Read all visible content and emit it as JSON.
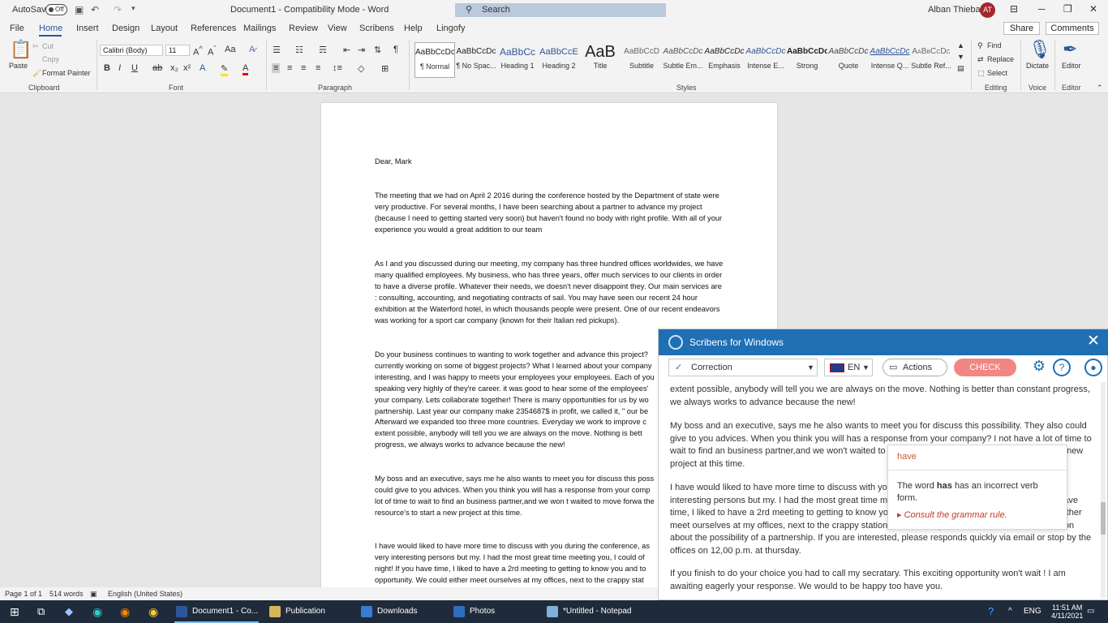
{
  "titlebar": {
    "autosave_label": "AutoSave",
    "autosave_state": "Off",
    "title": "Document1  -  Compatibility Mode  -  Word",
    "search_placeholder": "Search",
    "user_name": "Alban Thiebaut",
    "user_initials": "AT"
  },
  "menubar": {
    "tabs": [
      "File",
      "Home",
      "Insert",
      "Design",
      "Layout",
      "References",
      "Mailings",
      "Review",
      "View",
      "Scribens",
      "Help",
      "Lingofy"
    ],
    "active_tab": "Home",
    "share_label": "Share",
    "comments_label": "Comments"
  },
  "ribbon": {
    "clipboard": {
      "paste": "Paste",
      "cut": "Cut",
      "copy": "Copy",
      "format_painter": "Format Painter",
      "label": "Clipboard"
    },
    "font": {
      "name": "Calibri (Body)",
      "size": "11",
      "label": "Font"
    },
    "paragraph": {
      "label": "Paragraph"
    },
    "styles": {
      "label": "Styles",
      "items": [
        {
          "preview": "AaBbCcDc",
          "name": "¶ Normal"
        },
        {
          "preview": "AaBbCcDc",
          "name": "¶ No Spac..."
        },
        {
          "preview": "AaBbCc",
          "name": "Heading 1"
        },
        {
          "preview": "AaBbCcE",
          "name": "Heading 2"
        },
        {
          "preview": "AaB",
          "name": "Title"
        },
        {
          "preview": "AaBbCcD",
          "name": "Subtitle"
        },
        {
          "preview": "AaBbCcDc",
          "name": "Subtle Em..."
        },
        {
          "preview": "AaBbCcDc",
          "name": "Emphasis"
        },
        {
          "preview": "AaBbCcDc",
          "name": "Intense E..."
        },
        {
          "preview": "AaBbCcDc",
          "name": "Strong"
        },
        {
          "preview": "AaBbCcDc",
          "name": "Quote"
        },
        {
          "preview": "AaBbCcDc",
          "name": "Intense Q..."
        },
        {
          "preview": "AaBbCcDc",
          "name": "Subtle Ref..."
        }
      ]
    },
    "editing": {
      "find": "Find",
      "replace": "Replace",
      "select": "Select",
      "label": "Editing"
    },
    "voice": {
      "dictate": "Dictate",
      "label": "Voice"
    },
    "editor": {
      "editor": "Editor",
      "label": "Editor"
    }
  },
  "document": {
    "salutation": "Dear, Mark",
    "p1": "The meeting that we had on April 2 2016 during the conference hosted by the Department of state were very productive. For several months, I have been searching about a partner to advance my project (because I need to getting started very soon) but haven't found no body with right profile. With all of your experience you would a great addition to our team",
    "p2": "As I and you discussed during our meeting, my company has three hundred offices worldwides, we have many qualified employees. My business, who has three years, offer much services to our clients in order to have a diverse profile. Whatever their needs, we doesn't never disappoint they. Our main services are : consulting, accounting, and negotiating contracts of sail. You may have seen our recent 24 hour exhibition at the Waterford hotel, in which thousands people were present. One of our recent endeavors was working for a sport car company (known for their Italian red pickups).",
    "p3": "Do your business continues to wanting to work together and advance this project? currently working on some of biggest projects? What I learned about your company interesting, and I was happy to meets your employees your employees. Each of you speaking very highly of they're career. it was good to hear some of the employees' your company. Lets collaborate together! There is many opportunities for us by wo partnership. Last year our company make 2354687$ in profit, we called it, \" our be Afterward we expanded too three more countries. Everyday we work to improve c extent possible, anybody will tell you we are always on the move.   Nothing is bett progress, we always works to advance because the new!",
    "p4": "My boss and an executive, says me he also wants to meet you for discuss this poss could give to you advices. When you think you will has a response from your comp lot of time to wait to find an business partner,and we won t waited to move forwa the resource's to start a new project at this time.",
    "p5": "I have would liked to have more time to discuss with you during the conference, as very interesting persons but my. I had the most great time meeting you, I could of night! If you have time, I liked to have a 2rd meeting to getting to know you and to opportunity. We could either meet ourselves at my offices, next to the crappy stat"
  },
  "statusbar": {
    "page": "Page 1 of 1",
    "words": "514 words",
    "language": "English (United States)"
  },
  "scribens": {
    "title": "Scribens for Windows",
    "mode": "Correction",
    "language": "EN",
    "actions": "Actions",
    "check": "CHECK",
    "panel_p0": "extent possible, anybody will tell you we are always on the move.  Nothing is better than constant progress, we always works to advance because the new!",
    "panel_p1": "My boss and an executive, says me he also wants to meet you for discuss this possibility. They also could give to you advices. When you think you will has a response from your company? I not have a lot of time to wait to find an business partner,and we won't waited to move forward to use the resource's to start a new project at this time.",
    "panel_p2": "I have would liked to have more time to discuss with you during the conference, as you seem a very interesting persons but my. I had the most great time meeting you, I could of talked all night! If you have time, I liked to have a 2rd meeting to getting to know you and to discuss this opportunity. We could either meet ourselves at my offices, next to the crappy station on the twenty fifth floor, to have a conversation about the possibility of a partnership. If you are interested, please responds quickly via email or stop by the offices on 12,00 p.m. at thursday.",
    "panel_p3": "If you finish to do your choice you had to call my secratary. This exciting  opportunity won't wait ! I am awaiting eagerly your response. We would to be happy too have you.",
    "popup": {
      "suggestion": "have",
      "explanation_pre": "The word ",
      "explanation_word": "has",
      "explanation_post": " has an incorrect verb form.",
      "link": "Consult the grammar rule."
    }
  },
  "taskbar": {
    "apps": [
      "Document1 - Co...",
      "Publication",
      "Downloads",
      "Photos",
      "*Untitled - Notepad"
    ],
    "lang": "ENG",
    "time": "11:51 AM",
    "date": "4/11/2021"
  },
  "colors": {
    "word_blue": "#2b579a",
    "scribens_blue": "#1f6fb5",
    "check_red": "#f28682",
    "taskbar": "#1f2a3a"
  }
}
